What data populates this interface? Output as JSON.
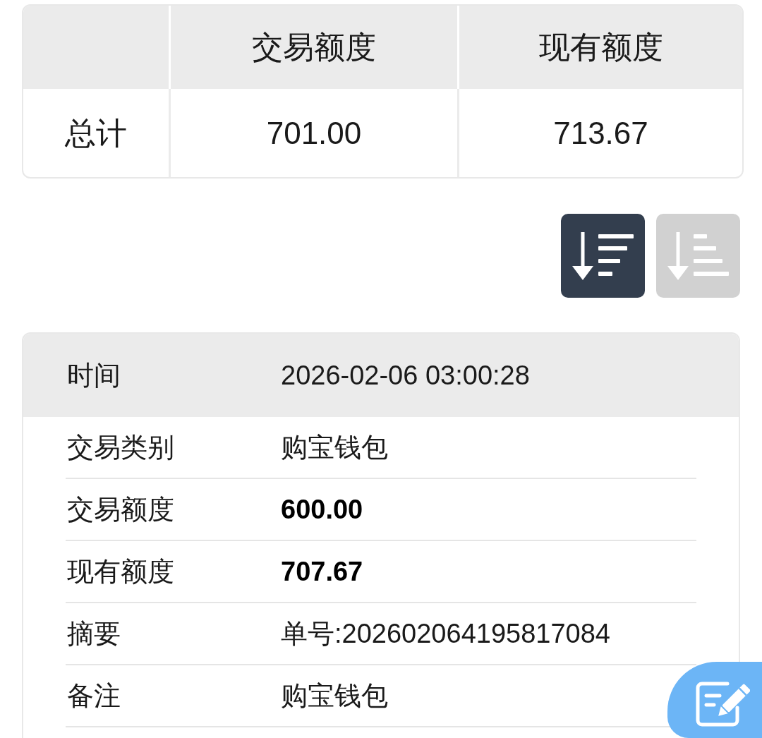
{
  "summary_table": {
    "columns": [
      "交易额度",
      "现有额度"
    ],
    "rows": [
      {
        "label": "总计",
        "cells": [
          "701.00",
          "713.67"
        ]
      }
    ]
  },
  "sort_buttons": [
    {
      "kind": "descending",
      "selected": true
    },
    {
      "kind": "ascending",
      "selected": false
    }
  ],
  "record": {
    "header": {
      "label": "时间",
      "value": "2026-02-06 03:00:28"
    },
    "fields": [
      {
        "label": "交易类别",
        "value": "购宝钱包",
        "emphasized": false
      },
      {
        "label": "交易额度",
        "value": "600.00",
        "emphasized": true
      },
      {
        "label": "现有额度",
        "value": "707.67",
        "emphasized": true
      },
      {
        "label": "摘要",
        "value": "单号:202602064195817084",
        "emphasized": false
      },
      {
        "label": "备注",
        "value": "购宝钱包",
        "emphasized": false
      }
    ]
  }
}
